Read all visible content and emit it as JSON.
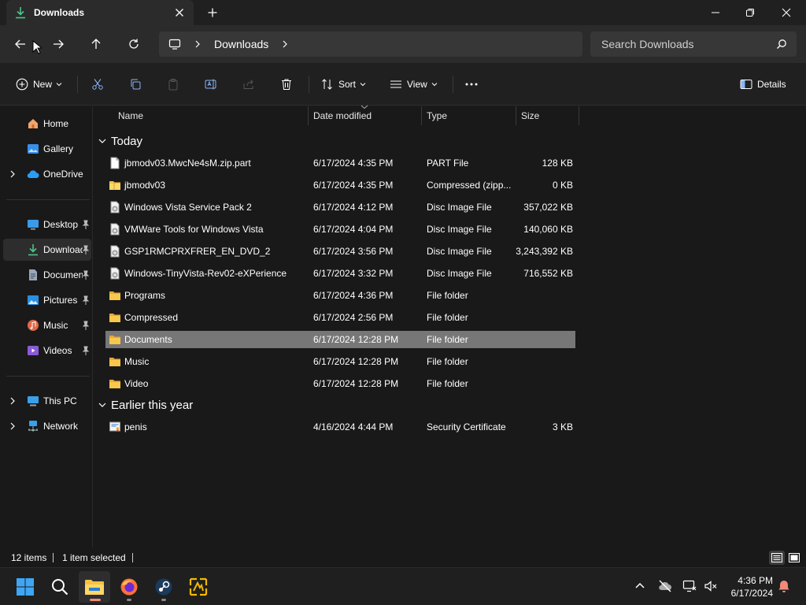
{
  "title_bar": {
    "tab_label": "Downloads",
    "new_tab_symbol": "+"
  },
  "address_bar": {
    "crumb": "Downloads",
    "search_placeholder": "Search Downloads"
  },
  "command_bar": {
    "new_label": "New",
    "sort_label": "Sort",
    "view_label": "View",
    "details_label": "Details"
  },
  "sidebar": {
    "items": [
      {
        "label": "Home",
        "icon": "home-icon"
      },
      {
        "label": "Gallery",
        "icon": "gallery-icon"
      },
      {
        "label": "OneDrive",
        "icon": "cloud-icon"
      },
      {
        "label": "Desktop",
        "icon": "desktop-icon"
      },
      {
        "label": "Downloads",
        "icon": "download-icon"
      },
      {
        "label": "Documents",
        "icon": "documents-icon"
      },
      {
        "label": "Pictures",
        "icon": "pictures-icon"
      },
      {
        "label": "Music",
        "icon": "music-icon"
      },
      {
        "label": "Videos",
        "icon": "videos-icon"
      },
      {
        "label": "This PC",
        "icon": "pc-icon"
      },
      {
        "label": "Network",
        "icon": "network-icon"
      }
    ]
  },
  "columns": {
    "name": "Name",
    "date": "Date modified",
    "type": "Type",
    "size": "Size"
  },
  "groups": {
    "today": "Today",
    "earlier": "Earlier this year"
  },
  "files": [
    {
      "name": "jbmodv03.MwcNe4sM.zip.part",
      "date": "6/17/2024 4:35 PM",
      "type": "PART File",
      "size": "128 KB",
      "icon": "file-icon"
    },
    {
      "name": "jbmodv03",
      "date": "6/17/2024 4:35 PM",
      "type": "Compressed (zipp...",
      "size": "0 KB",
      "icon": "zip-folder-icon"
    },
    {
      "name": "Windows Vista Service Pack 2",
      "date": "6/17/2024 4:12 PM",
      "type": "Disc Image File",
      "size": "357,022 KB",
      "icon": "disc-image-icon"
    },
    {
      "name": "VMWare Tools for Windows Vista",
      "date": "6/17/2024 4:04 PM",
      "type": "Disc Image File",
      "size": "140,060 KB",
      "icon": "disc-image-icon"
    },
    {
      "name": "GSP1RMCPRXFRER_EN_DVD_2",
      "date": "6/17/2024 3:56 PM",
      "type": "Disc Image File",
      "size": "3,243,392 KB",
      "icon": "disc-image-icon"
    },
    {
      "name": "Windows-TinyVista-Rev02-eXPerience",
      "date": "6/17/2024 3:32 PM",
      "type": "Disc Image File",
      "size": "716,552 KB",
      "icon": "disc-image-icon"
    },
    {
      "name": "Programs",
      "date": "6/17/2024 4:36 PM",
      "type": "File folder",
      "size": "",
      "icon": "folder-icon"
    },
    {
      "name": "Compressed",
      "date": "6/17/2024 2:56 PM",
      "type": "File folder",
      "size": "",
      "icon": "folder-icon"
    },
    {
      "name": "Documents",
      "date": "6/17/2024 12:28 PM",
      "type": "File folder",
      "size": "",
      "icon": "folder-icon",
      "selected": true
    },
    {
      "name": "Music",
      "date": "6/17/2024 12:28 PM",
      "type": "File folder",
      "size": "",
      "icon": "folder-icon"
    },
    {
      "name": "Video",
      "date": "6/17/2024 12:28 PM",
      "type": "File folder",
      "size": "",
      "icon": "folder-icon"
    }
  ],
  "earlier_files": [
    {
      "name": "penis",
      "date": "4/16/2024 4:44 PM",
      "type": "Security Certificate",
      "size": "3 KB",
      "icon": "certificate-icon"
    }
  ],
  "status": {
    "item_count": "12 items",
    "selected": "1 item selected"
  },
  "taskbar": {
    "time": "4:36 PM",
    "date": "6/17/2024"
  },
  "colors": {
    "accent_green": "#4ec48a",
    "folder_yellow": "#f5c244",
    "selection_gray": "#777777"
  }
}
